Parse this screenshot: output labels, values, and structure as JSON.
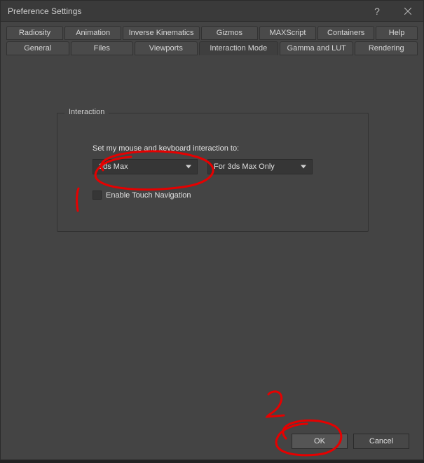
{
  "window": {
    "title": "Preference Settings"
  },
  "tabs": {
    "row1": [
      {
        "label": "Radiosity"
      },
      {
        "label": "Animation"
      },
      {
        "label": "Inverse Kinematics"
      },
      {
        "label": "Gizmos"
      },
      {
        "label": "MAXScript"
      },
      {
        "label": "Containers"
      },
      {
        "label": "Help"
      }
    ],
    "row2": [
      {
        "label": "General"
      },
      {
        "label": "Files"
      },
      {
        "label": "Viewports"
      },
      {
        "label": "Interaction Mode"
      },
      {
        "label": "Gamma and LUT"
      },
      {
        "label": "Rendering"
      }
    ],
    "active": "Interaction Mode"
  },
  "group": {
    "title": "Interaction",
    "prompt": "Set my mouse and keyboard interaction to:",
    "mode": {
      "value": "3ds Max"
    },
    "scope": {
      "value": "For 3ds Max Only"
    },
    "touch_label": "Enable Touch Navigation",
    "touch_checked": false
  },
  "buttons": {
    "ok": "OK",
    "cancel": "Cancel"
  },
  "annotations": {
    "mark1": "1",
    "mark2": "2"
  }
}
